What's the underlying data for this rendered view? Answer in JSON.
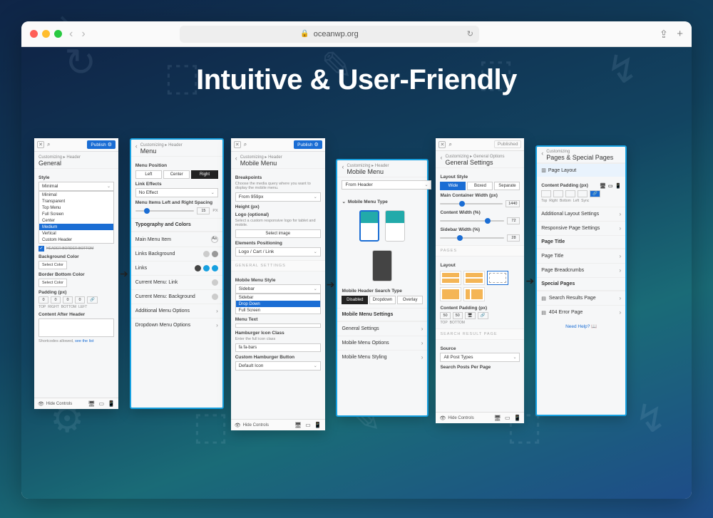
{
  "browser": {
    "url_host": "oceanwp.org"
  },
  "hero": {
    "headline": "Intuitive & User-Friendly"
  },
  "panel1": {
    "publish_label": "Publish",
    "breadcrumb": "Customizing ▸ Header",
    "title": "General",
    "style_label": "Style",
    "style_value": "Minimal",
    "style_options": [
      "Minimal",
      "Transparent",
      "Top Menu",
      "Full Screen",
      "Center",
      "Medium",
      "Vertical",
      "Custom Header"
    ],
    "header_border_bottom": "HEADER BORDER BOTTOM",
    "bg_color_label": "Background Color",
    "select_color": "Select Color",
    "border_bottom_color_label": "Border Bottom Color",
    "padding_label": "Padding (px)",
    "padding_tabs": [
      "TOP",
      "RIGHT",
      "BOTTOM",
      "LEFT"
    ],
    "content_after_header": "Content After Header",
    "shortcodes_note": "Shortcodes allowed,",
    "shortcodes_link": "see the list",
    "hide_controls": "Hide Controls"
  },
  "panel2": {
    "breadcrumb": "Customizing ▸ Header",
    "title": "Menu",
    "menu_position_label": "Menu Position",
    "pos_left": "Left",
    "pos_center": "Center",
    "pos_right": "Right",
    "link_effects_label": "Link Effects",
    "link_effects_value": "No Effect",
    "spacing_label": "Menu Items Left and Right Spacing",
    "spacing_val": "15",
    "typography_header": "Typography and Colors",
    "main_menu_item": "Main Menu Item",
    "links_bg": "Links Background",
    "links": "Links",
    "cur_link": "Current Menu: Link",
    "cur_bg": "Current Menu: Background",
    "additional": "Additional Menu Options",
    "dropdown": "Dropdown Menu Options"
  },
  "panel3": {
    "publish_label": "Publish",
    "breadcrumb": "Customizing ▸ Header",
    "title": "Mobile Menu",
    "breakpoints_label": "Breakpoints",
    "breakpoints_note": "Choose the media query where you want to display the mobile menu.",
    "breakpoints_value": "From 959px",
    "height_label": "Height (px)",
    "logo_label": "Logo (optional)",
    "logo_note": "Select a custom responsive logo for tablet and mobile.",
    "select_image": "Select image",
    "elements_label": "Elements Positioning",
    "elements_value": "Logo / Cart / Link",
    "general_divider": "GENERAL SETTINGS",
    "mobile_style_label": "Mobile Menu Style",
    "mobile_style_value": "Sidebar",
    "mobile_style_options": [
      "Sidebar",
      "Drop Down",
      "Full Screen"
    ],
    "menu_text_label": "Menu Text",
    "hamburger_label": "Hamburger Icon Class",
    "hamburger_note": "Enter the full icon class",
    "hamburger_value": "fa fa-bars",
    "custom_ham_label": "Custom Hamburger Button",
    "custom_ham_value": "Default Icon",
    "hide_controls": "Hide Controls"
  },
  "panel4": {
    "breadcrumb": "Customizing ▸ Header",
    "title": "Mobile Menu",
    "from_header": "From Header",
    "type_label": "Mobile Menu Type",
    "search_label": "Mobile Header Search Type",
    "s_disabled": "Disabled",
    "s_dropdown": "Dropdown",
    "s_overlay": "Overlay",
    "settings_header": "Mobile Menu Settings",
    "general": "General Settings",
    "options": "Mobile Menu Options",
    "styling": "Mobile Menu Styling"
  },
  "panel5": {
    "published_label": "Published",
    "breadcrumb": "Customizing ▸ General Options",
    "title": "General Settings",
    "layout_style": "Layout Style",
    "wide": "Wide",
    "boxed": "Boxed",
    "separate": "Separate",
    "main_w": "Main Container Width (px)",
    "main_w_val": "1440",
    "content_w": "Content Width (%)",
    "content_w_val": "72",
    "sidebar_w": "Sidebar Width (%)",
    "sidebar_w_val": "28",
    "pages_divider": "PAGES",
    "layout_label": "Layout",
    "content_padding": "Content Padding (px)",
    "cp_tabs": [
      "TOP",
      "BOTTOM"
    ],
    "cp_vals": [
      "50",
      "50"
    ],
    "search_divider": "SEARCH RESULT PAGE",
    "source_label": "Source",
    "source_value": "All Post Types",
    "search_posts": "Search Posts Per Page",
    "hide_controls": "Hide Controls"
  },
  "panel6": {
    "breadcrumb": "Customizing",
    "title": "Pages & Special Pages",
    "page_layout": "Page Layout",
    "content_padding": "Content Padding (px)",
    "cp_tabs": [
      "Top",
      "Right",
      "Bottom",
      "Left",
      "Sync"
    ],
    "additional": "Additional Layout Settings",
    "responsive": "Responsive Page Settings",
    "page_title_h": "Page Title",
    "page_title": "Page Title",
    "breadcrumbs": "Page Breadcrumbs",
    "special_h": "Special Pages",
    "search_results": "Search Results Page",
    "error_page": "404 Error Page",
    "need_help": "Need Help?"
  }
}
